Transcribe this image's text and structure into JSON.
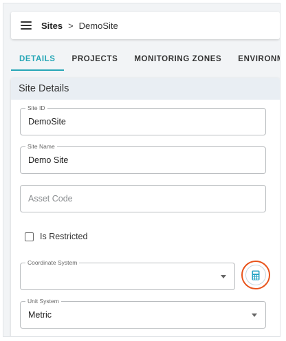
{
  "header": {
    "breadcrumb_root": "Sites",
    "breadcrumb_separator": ">",
    "breadcrumb_current": "DemoSite"
  },
  "tabs": [
    {
      "label": "DETAILS",
      "active": true
    },
    {
      "label": "PROJECTS",
      "active": false
    },
    {
      "label": "MONITORING ZONES",
      "active": false
    },
    {
      "label": "ENVIRONMENTAL",
      "active": false
    }
  ],
  "card": {
    "title": "Site Details",
    "site_id": {
      "label": "Site ID",
      "value": "DemoSite"
    },
    "site_name": {
      "label": "Site Name",
      "value": "Demo Site"
    },
    "asset_code": {
      "placeholder": "Asset Code",
      "value": ""
    },
    "is_restricted": {
      "label": "Is Restricted",
      "checked": false
    },
    "coordinate_system": {
      "label": "Coordinate System",
      "value": ""
    },
    "unit_system": {
      "label": "Unit System",
      "value": "Metric"
    }
  },
  "icons": {
    "menu": "hamburger-icon",
    "calculator": "calculator-icon",
    "dropdown": "chevron-down-icon"
  },
  "colors": {
    "accent": "#26a6b6",
    "highlight_ring": "#e8541c",
    "card_header_bg": "#e9eef3"
  }
}
